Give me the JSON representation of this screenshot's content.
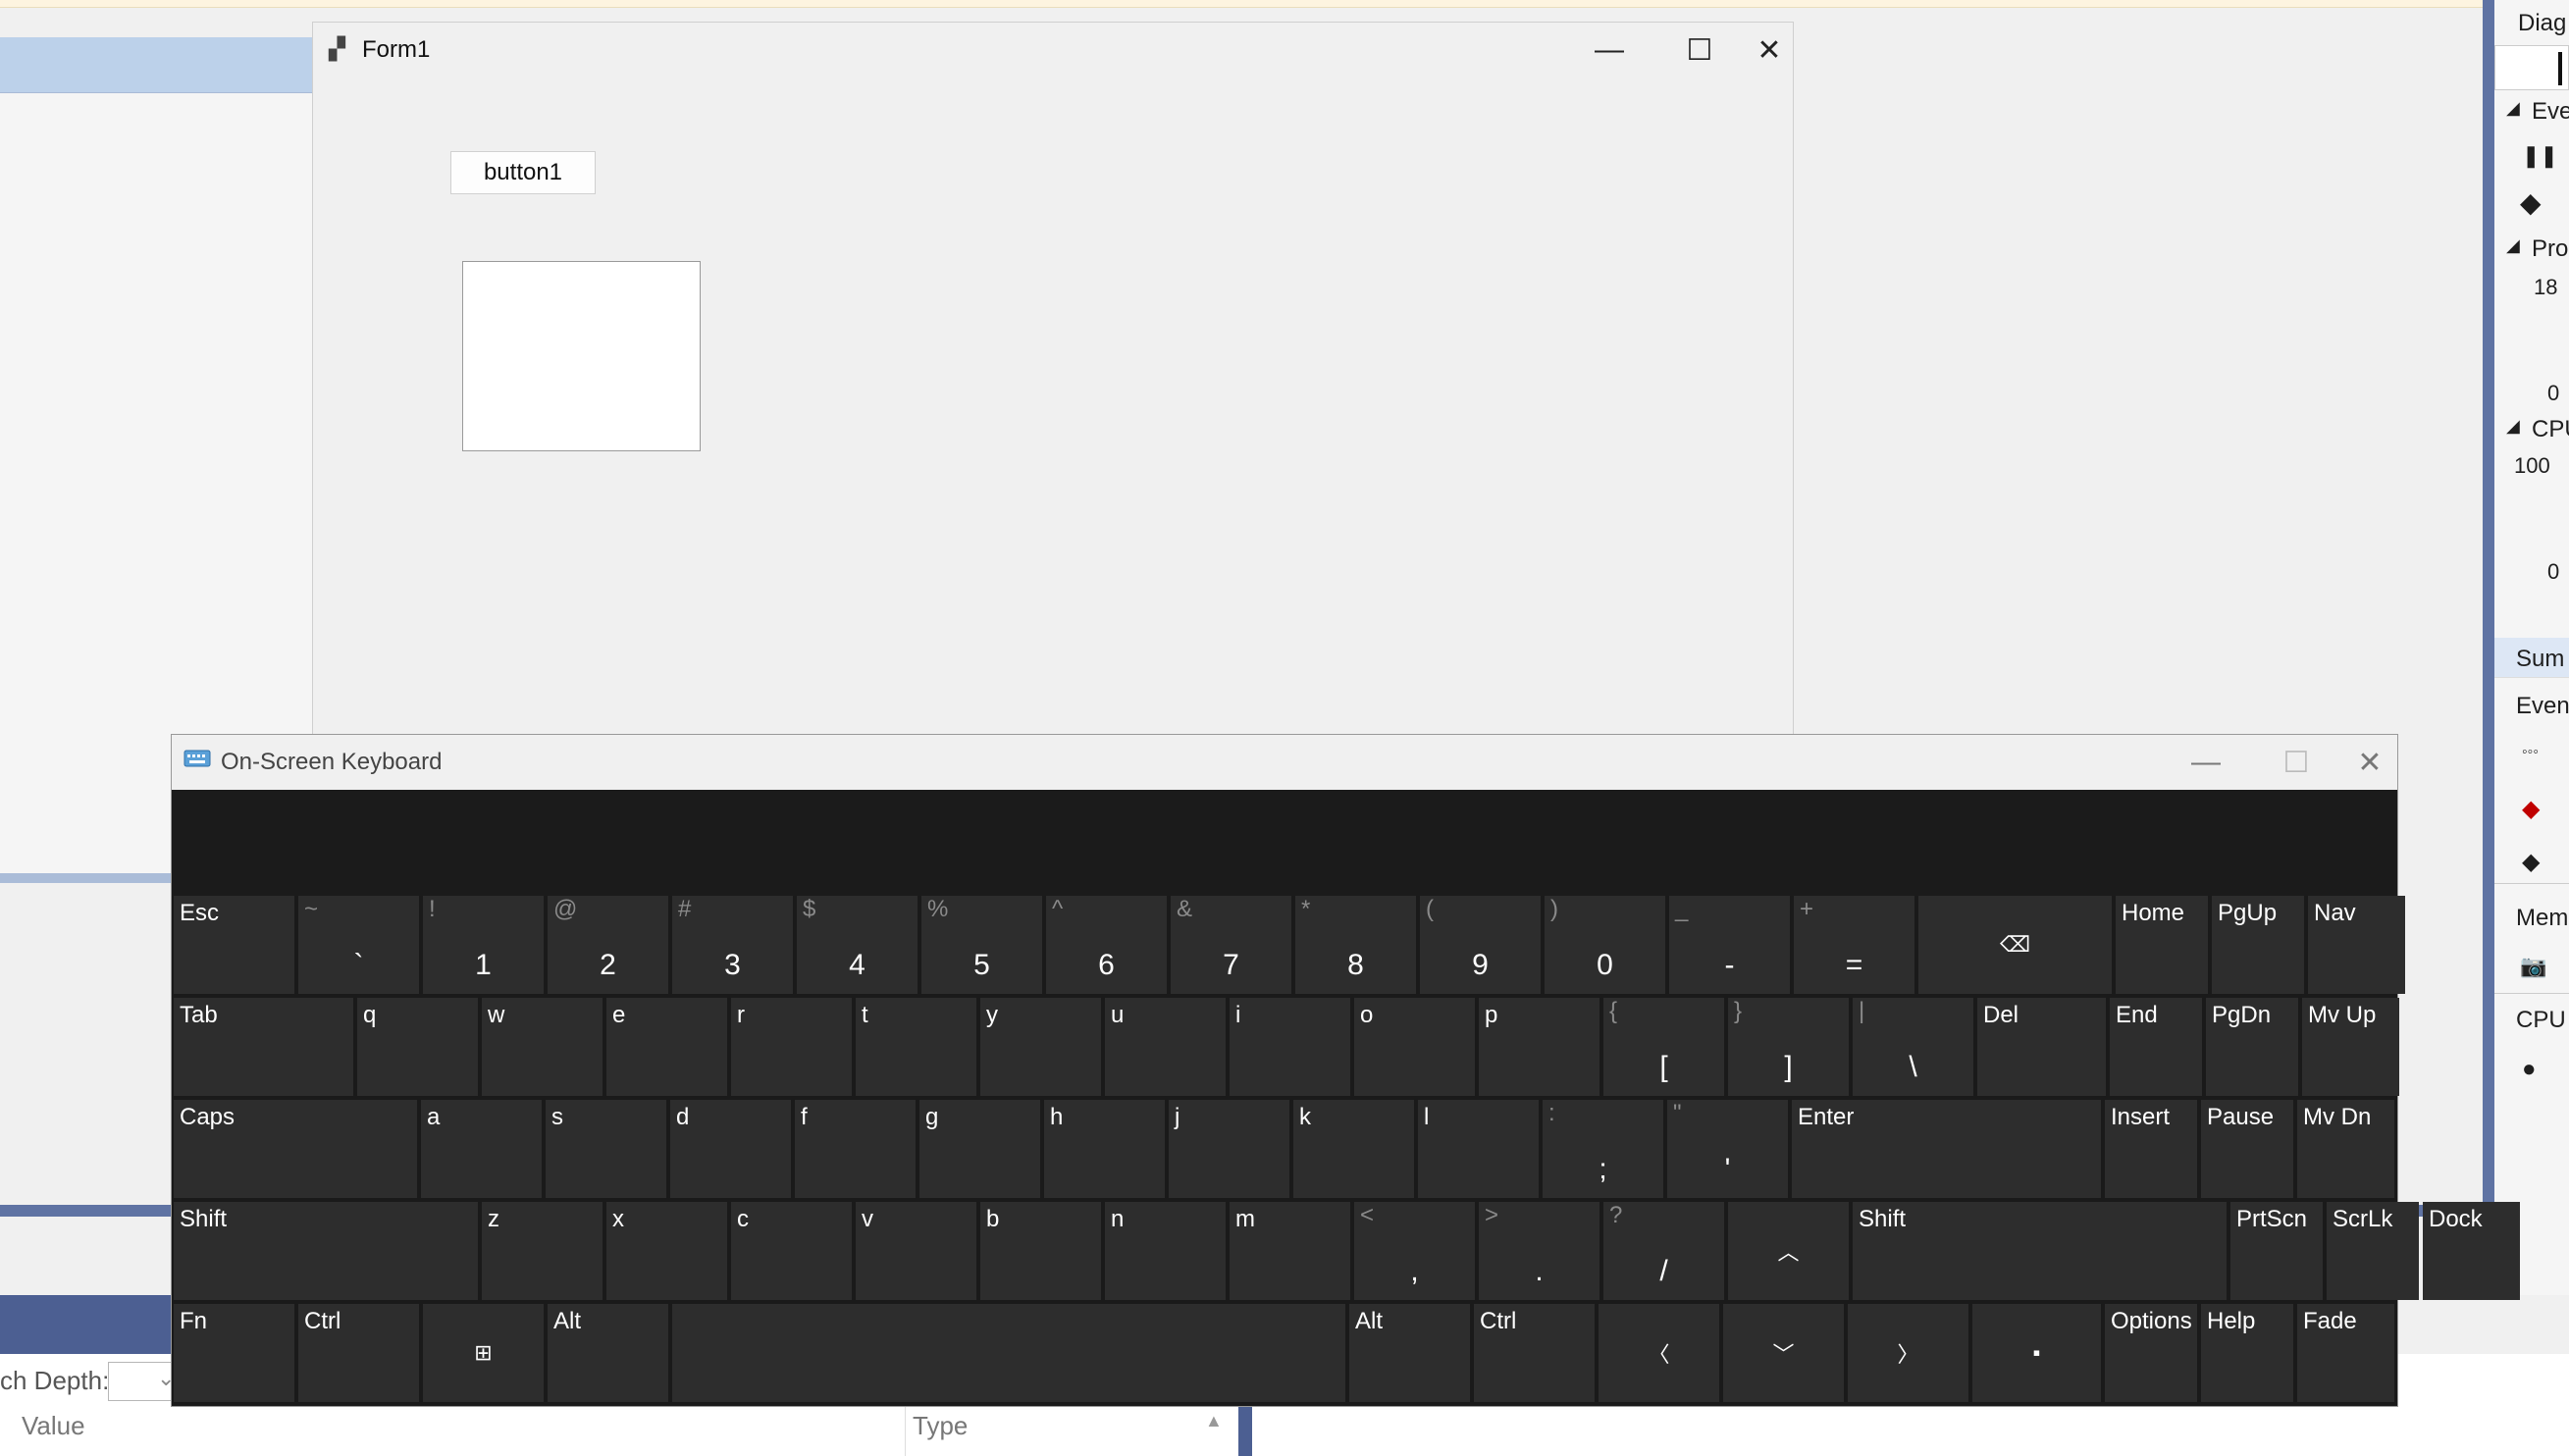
{
  "form1": {
    "title": "Form1",
    "button1": "button1",
    "controls": {
      "minimize": "—",
      "maximize": "☐",
      "close": "✕"
    }
  },
  "osk": {
    "title": "On-Screen Keyboard",
    "controls": {
      "minimize": "—",
      "maximize": "☐",
      "close": "✕"
    },
    "rows": [
      [
        {
          "label": "Esc"
        },
        {
          "shift": "~",
          "main": "`"
        },
        {
          "shift": "!",
          "main": "1"
        },
        {
          "shift": "@",
          "main": "2"
        },
        {
          "shift": "#",
          "main": "3"
        },
        {
          "shift": "$",
          "main": "4"
        },
        {
          "shift": "%",
          "main": "5"
        },
        {
          "shift": "^",
          "main": "6"
        },
        {
          "shift": "&",
          "main": "7"
        },
        {
          "shift": "*",
          "main": "8"
        },
        {
          "shift": "(",
          "main": "9"
        },
        {
          "shift": ")",
          "main": "0"
        },
        {
          "shift": "_",
          "main": "-"
        },
        {
          "shift": "+",
          "main": "="
        },
        {
          "icon": "⌫",
          "name": "backspace-key"
        },
        {
          "label": "Home"
        },
        {
          "label": "PgUp"
        },
        {
          "label": "Nav"
        }
      ],
      [
        {
          "label": "Tab"
        },
        {
          "label": "q"
        },
        {
          "label": "w"
        },
        {
          "label": "e"
        },
        {
          "label": "r"
        },
        {
          "label": "t"
        },
        {
          "label": "y"
        },
        {
          "label": "u"
        },
        {
          "label": "i"
        },
        {
          "label": "o"
        },
        {
          "label": "p"
        },
        {
          "shift": "{",
          "main": "["
        },
        {
          "shift": "}",
          "main": "]"
        },
        {
          "shift": "|",
          "main": "\\"
        },
        {
          "label": "Del"
        },
        {
          "label": "End"
        },
        {
          "label": "PgDn"
        },
        {
          "label": "Mv Up"
        }
      ],
      [
        {
          "label": "Caps"
        },
        {
          "label": "a"
        },
        {
          "label": "s"
        },
        {
          "label": "d"
        },
        {
          "label": "f"
        },
        {
          "label": "g"
        },
        {
          "label": "h"
        },
        {
          "label": "j"
        },
        {
          "label": "k"
        },
        {
          "label": "l"
        },
        {
          "shift": ":",
          "main": ";"
        },
        {
          "shift": "\"",
          "main": "'"
        },
        {
          "label": "Enter"
        },
        {
          "label": "Insert"
        },
        {
          "label": "Pause"
        },
        {
          "label": "Mv Dn"
        }
      ],
      [
        {
          "label": "Shift"
        },
        {
          "label": "z"
        },
        {
          "label": "x"
        },
        {
          "label": "c"
        },
        {
          "label": "v"
        },
        {
          "label": "b"
        },
        {
          "label": "n"
        },
        {
          "label": "m"
        },
        {
          "shift": "<",
          "main": ","
        },
        {
          "shift": ">",
          "main": "."
        },
        {
          "shift": "?",
          "main": "/"
        },
        {
          "icon": "︿",
          "name": "up-arrow-key"
        },
        {
          "label": "Shift"
        },
        {
          "label": "PrtScn"
        },
        {
          "label": "ScrLk"
        },
        {
          "label": "Dock"
        }
      ],
      [
        {
          "label": "Fn"
        },
        {
          "label": "Ctrl"
        },
        {
          "icon": "⊞",
          "name": "windows-key"
        },
        {
          "label": "Alt"
        },
        {
          "label": "",
          "name": "space-key"
        },
        {
          "label": "Alt"
        },
        {
          "label": "Ctrl"
        },
        {
          "icon": "〈",
          "name": "left-arrow-key"
        },
        {
          "icon": "﹀",
          "name": "down-arrow-key"
        },
        {
          "icon": "〉",
          "name": "right-arrow-key"
        },
        {
          "icon": "▪",
          "name": "menu-key"
        },
        {
          "label": "Options"
        },
        {
          "label": "Help"
        },
        {
          "label": "Fade"
        }
      ]
    ]
  },
  "diagnostics": {
    "header": "Diag",
    "events_section": "Eve",
    "process_section": "Pro",
    "process_max": "18",
    "process_min": "0",
    "cpu_section": "CPU",
    "cpu_max": "100",
    "cpu_min": "0",
    "tab_summary": "Sum",
    "tab_events": "Even",
    "tab_memory": "Mem",
    "tab_cpu": "CPU"
  },
  "bottom_panel": {
    "search_depth_label": "ch Depth:",
    "col_value": "Value",
    "col_type": "Type"
  }
}
